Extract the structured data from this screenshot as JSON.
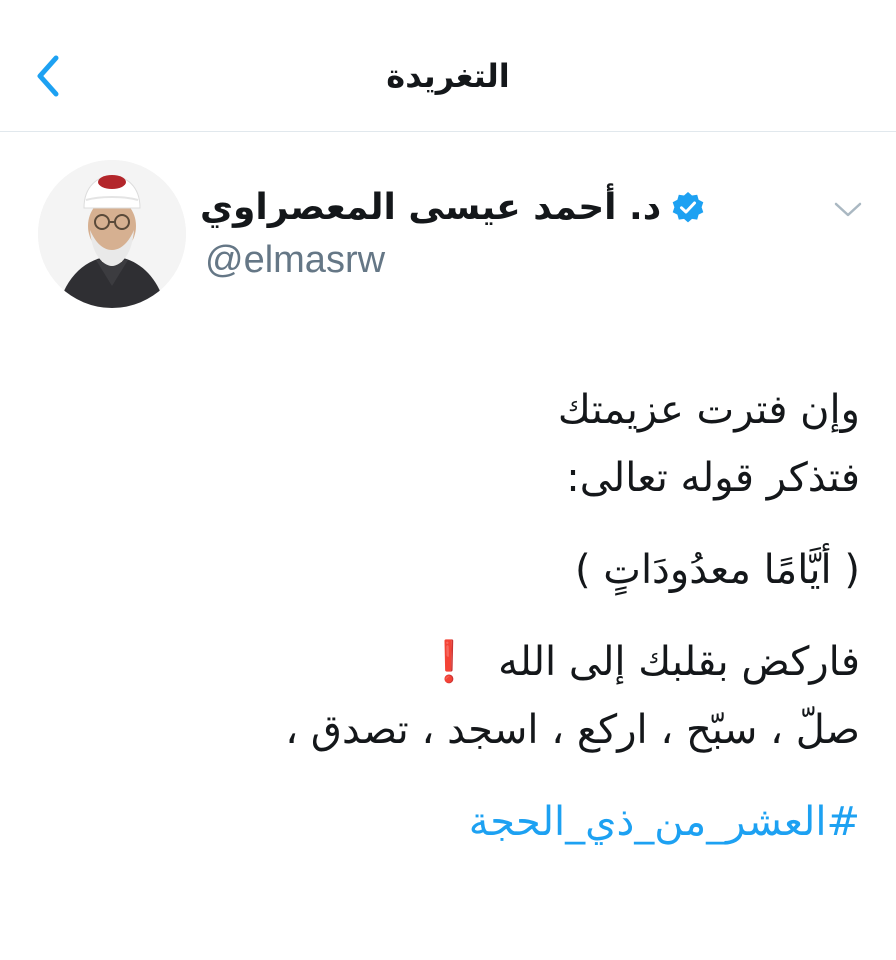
{
  "header": {
    "title": "التغريدة"
  },
  "user": {
    "display_name": "د. أحمد عيسى المعصراوي",
    "handle": "@elmasrw",
    "verified": true
  },
  "tweet": {
    "line1": "وإن فترت عزيمتك",
    "line2": "فتذكر قوله تعالى:",
    "line3": "( أيَّامًا معدُودَاتٍ )",
    "line4": "فاركض بقلبك إلى الله",
    "line4_emoji": "❗",
    "line5": "صلّ ، سبّح ، اركع ، اسجد ، تصدق ،",
    "hashtag": "#العشر_من_ذي_الحجة"
  },
  "colors": {
    "accent": "#1da1f2",
    "verified": "#1da1f2",
    "exclamation": "#e0201b",
    "secondary_text": "#657786"
  },
  "icons": {
    "back": "chevron-left-icon",
    "verified": "verified-badge-icon",
    "more": "chevron-down-icon"
  }
}
